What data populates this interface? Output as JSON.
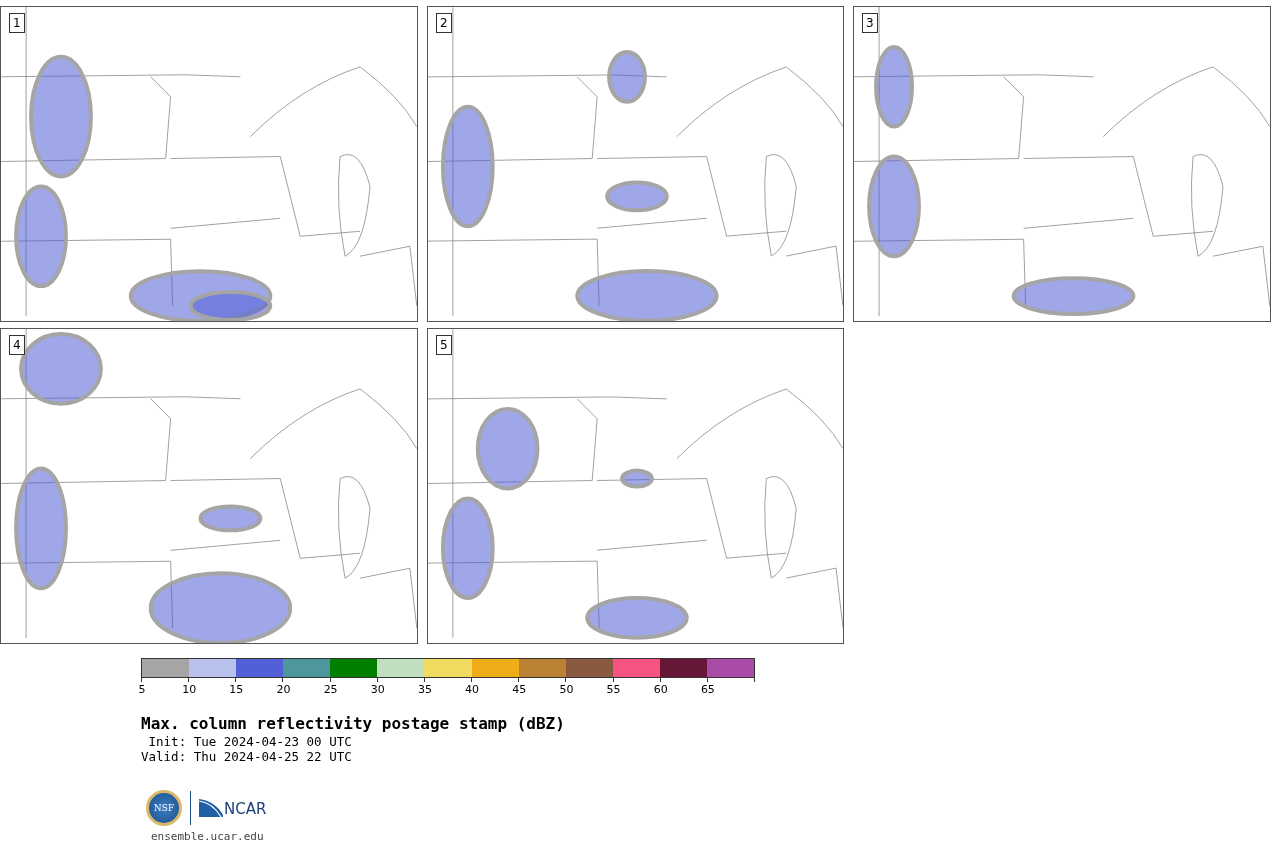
{
  "panels": [
    {
      "label": "1"
    },
    {
      "label": "2"
    },
    {
      "label": "3"
    },
    {
      "label": "4"
    },
    {
      "label": "5"
    }
  ],
  "colorbar": {
    "segments": [
      {
        "color": "#a5a5a5",
        "tick": "5"
      },
      {
        "color": "#b8c2ec",
        "tick": "10"
      },
      {
        "color": "#525fd6",
        "tick": "15"
      },
      {
        "color": "#4e959c",
        "tick": "20"
      },
      {
        "color": "#008000",
        "tick": "25"
      },
      {
        "color": "#c0dec0",
        "tick": "30"
      },
      {
        "color": "#f0da60",
        "tick": "35"
      },
      {
        "color": "#f0ad1a",
        "tick": "40"
      },
      {
        "color": "#ba8232",
        "tick": "45"
      },
      {
        "color": "#8a5a3e",
        "tick": "50"
      },
      {
        "color": "#f55380",
        "tick": "55"
      },
      {
        "color": "#661637",
        "tick": "60"
      },
      {
        "color": "#ab4ba8",
        "tick": "65"
      }
    ]
  },
  "title": "Max. column reflectivity postage stamp (dBZ)",
  "init": " Init: Tue 2024-04-23 00 UTC",
  "valid": "Valid: Thu 2024-04-25 22 UTC",
  "logo": {
    "nsf": "NSF",
    "ncar": "NCAR"
  },
  "footer_link": "ensemble.ucar.edu"
}
